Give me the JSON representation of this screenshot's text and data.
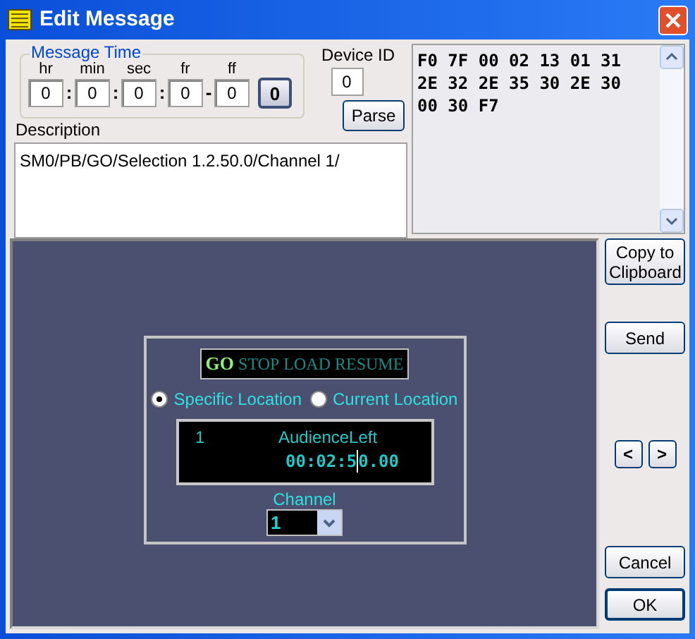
{
  "window": {
    "title": "Edit Message"
  },
  "message_time": {
    "label": "Message Time",
    "fields": [
      {
        "label": "hr",
        "value": "0",
        "separator": ":"
      },
      {
        "label": "min",
        "value": "0",
        "separator": ":"
      },
      {
        "label": "sec",
        "value": "0",
        "separator": ":"
      },
      {
        "label": "fr",
        "value": "0",
        "separator": "-"
      },
      {
        "label": "ff",
        "value": "0"
      }
    ],
    "button": "0"
  },
  "device_id": {
    "label": "Device ID",
    "value": "0"
  },
  "parse_button": "Parse",
  "description": {
    "label": "Description",
    "value": "SM0/PB/GO/Selection 1.2.50.0/Channel 1/"
  },
  "hex_output": {
    "lines": [
      "F0 7F 00 02 13 01 31",
      "2E 32 2E 35 30 2E 30",
      "00 30 F7"
    ]
  },
  "commands": [
    {
      "label": "GO",
      "selected": true
    },
    {
      "label": "STOP",
      "selected": false
    },
    {
      "label": "LOAD",
      "selected": false
    },
    {
      "label": "RESUME",
      "selected": false
    }
  ],
  "location_options": [
    {
      "label": "Specific Location",
      "selected": true
    },
    {
      "label": "Current Location",
      "selected": false
    }
  ],
  "cue_display": {
    "number": "1",
    "name": "AudienceLeft",
    "time_before_cursor": "00:02:5",
    "time_after_cursor": "0.00"
  },
  "channel": {
    "label": "Channel",
    "value": "1"
  },
  "side_buttons": {
    "copy": "Copy to Clipboard",
    "send": "Send",
    "previous": "<",
    "next": ">",
    "cancel": "Cancel",
    "ok": "OK"
  }
}
